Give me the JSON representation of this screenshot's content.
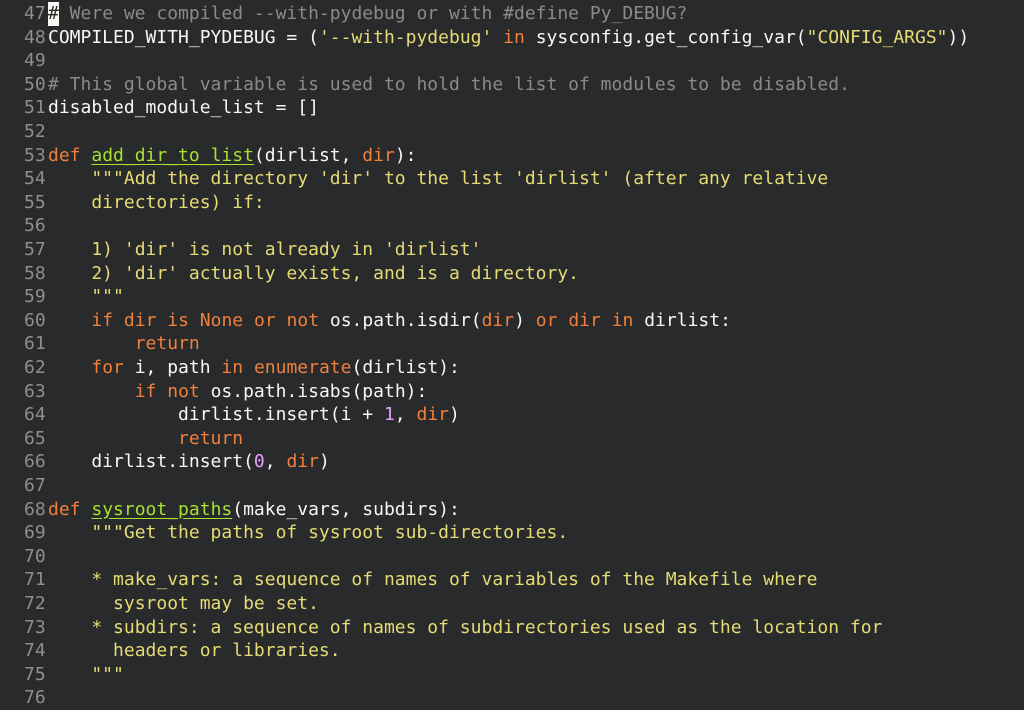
{
  "editor": {
    "lines": [
      {
        "n": "47",
        "tokens": [
          {
            "t": "#",
            "c": "cursor"
          },
          {
            "t": " Were we compiled --with-pydebug or with #define Py_DEBUG?",
            "c": "cm"
          }
        ]
      },
      {
        "n": "48",
        "tokens": [
          {
            "t": "COMPILED_WITH_PYDEBUG = (",
            "c": "pl"
          },
          {
            "t": "'--with-pydebug'",
            "c": "st"
          },
          {
            "t": " ",
            "c": "pl"
          },
          {
            "t": "in",
            "c": "kw"
          },
          {
            "t": " sysconfig.get_config_var(",
            "c": "pl"
          },
          {
            "t": "\"CONFIG_ARGS\"",
            "c": "st"
          },
          {
            "t": "))",
            "c": "pl"
          }
        ]
      },
      {
        "n": "49",
        "tokens": []
      },
      {
        "n": "50",
        "tokens": [
          {
            "t": "# This global variable is used to hold the list of modules to be disabled.",
            "c": "cm"
          }
        ]
      },
      {
        "n": "51",
        "tokens": [
          {
            "t": "disabled_module_list = []",
            "c": "pl"
          }
        ]
      },
      {
        "n": "52",
        "tokens": []
      },
      {
        "n": "53",
        "tokens": [
          {
            "t": "def",
            "c": "kw"
          },
          {
            "t": " ",
            "c": "pl"
          },
          {
            "t": "add_dir_to_list",
            "c": "fn"
          },
          {
            "t": "(dirlist, ",
            "c": "pl"
          },
          {
            "t": "dir",
            "c": "bi"
          },
          {
            "t": "):",
            "c": "pl"
          }
        ]
      },
      {
        "n": "54",
        "tokens": [
          {
            "t": "    \"\"\"Add the directory 'dir' to the list 'dirlist' (after any relative",
            "c": "st"
          }
        ]
      },
      {
        "n": "55",
        "tokens": [
          {
            "t": "    directories) if:",
            "c": "st"
          }
        ]
      },
      {
        "n": "56",
        "tokens": []
      },
      {
        "n": "57",
        "tokens": [
          {
            "t": "    1) 'dir' is not already in 'dirlist'",
            "c": "st"
          }
        ]
      },
      {
        "n": "58",
        "tokens": [
          {
            "t": "    2) 'dir' actually exists, and is a directory.",
            "c": "st"
          }
        ]
      },
      {
        "n": "59",
        "tokens": [
          {
            "t": "    \"\"\"",
            "c": "st"
          }
        ]
      },
      {
        "n": "60",
        "tokens": [
          {
            "t": "    ",
            "c": "pl"
          },
          {
            "t": "if",
            "c": "kw"
          },
          {
            "t": " ",
            "c": "pl"
          },
          {
            "t": "dir",
            "c": "bi"
          },
          {
            "t": " ",
            "c": "pl"
          },
          {
            "t": "is",
            "c": "kw"
          },
          {
            "t": " ",
            "c": "pl"
          },
          {
            "t": "None",
            "c": "bi"
          },
          {
            "t": " ",
            "c": "pl"
          },
          {
            "t": "or",
            "c": "kw"
          },
          {
            "t": " ",
            "c": "pl"
          },
          {
            "t": "not",
            "c": "kw"
          },
          {
            "t": " os.path.isdir(",
            "c": "pl"
          },
          {
            "t": "dir",
            "c": "bi"
          },
          {
            "t": ") ",
            "c": "pl"
          },
          {
            "t": "or",
            "c": "kw"
          },
          {
            "t": " ",
            "c": "pl"
          },
          {
            "t": "dir",
            "c": "bi"
          },
          {
            "t": " ",
            "c": "pl"
          },
          {
            "t": "in",
            "c": "kw"
          },
          {
            "t": " dirlist:",
            "c": "pl"
          }
        ]
      },
      {
        "n": "61",
        "tokens": [
          {
            "t": "        ",
            "c": "pl"
          },
          {
            "t": "return",
            "c": "kw"
          }
        ]
      },
      {
        "n": "62",
        "tokens": [
          {
            "t": "    ",
            "c": "pl"
          },
          {
            "t": "for",
            "c": "kw"
          },
          {
            "t": " i, path ",
            "c": "pl"
          },
          {
            "t": "in",
            "c": "kw"
          },
          {
            "t": " ",
            "c": "pl"
          },
          {
            "t": "enumerate",
            "c": "bi"
          },
          {
            "t": "(dirlist):",
            "c": "pl"
          }
        ]
      },
      {
        "n": "63",
        "tokens": [
          {
            "t": "        ",
            "c": "pl"
          },
          {
            "t": "if",
            "c": "kw"
          },
          {
            "t": " ",
            "c": "pl"
          },
          {
            "t": "not",
            "c": "kw"
          },
          {
            "t": " os.path.isabs(path):",
            "c": "pl"
          }
        ]
      },
      {
        "n": "64",
        "tokens": [
          {
            "t": "            dirlist.insert(i + ",
            "c": "pl"
          },
          {
            "t": "1",
            "c": "nm"
          },
          {
            "t": ", ",
            "c": "pl"
          },
          {
            "t": "dir",
            "c": "bi"
          },
          {
            "t": ")",
            "c": "pl"
          }
        ]
      },
      {
        "n": "65",
        "tokens": [
          {
            "t": "            ",
            "c": "pl"
          },
          {
            "t": "return",
            "c": "kw"
          }
        ]
      },
      {
        "n": "66",
        "tokens": [
          {
            "t": "    dirlist.insert(",
            "c": "pl"
          },
          {
            "t": "0",
            "c": "nm"
          },
          {
            "t": ", ",
            "c": "pl"
          },
          {
            "t": "dir",
            "c": "bi"
          },
          {
            "t": ")",
            "c": "pl"
          }
        ]
      },
      {
        "n": "67",
        "tokens": []
      },
      {
        "n": "68",
        "tokens": [
          {
            "t": "def",
            "c": "kw"
          },
          {
            "t": " ",
            "c": "pl"
          },
          {
            "t": "sysroot_paths",
            "c": "fn"
          },
          {
            "t": "(make_vars, subdirs):",
            "c": "pl"
          }
        ]
      },
      {
        "n": "69",
        "tokens": [
          {
            "t": "    \"\"\"Get the paths of sysroot sub-directories.",
            "c": "st"
          }
        ]
      },
      {
        "n": "70",
        "tokens": []
      },
      {
        "n": "71",
        "tokens": [
          {
            "t": "    * make_vars: a sequence of names of variables of the Makefile where",
            "c": "st"
          }
        ]
      },
      {
        "n": "72",
        "tokens": [
          {
            "t": "      sysroot may be set.",
            "c": "st"
          }
        ]
      },
      {
        "n": "73",
        "tokens": [
          {
            "t": "    * subdirs: a sequence of names of subdirectories used as the location for",
            "c": "st"
          }
        ]
      },
      {
        "n": "74",
        "tokens": [
          {
            "t": "      headers or libraries.",
            "c": "st"
          }
        ]
      },
      {
        "n": "75",
        "tokens": [
          {
            "t": "    \"\"\"",
            "c": "st"
          }
        ]
      },
      {
        "n": "76",
        "tokens": []
      }
    ]
  }
}
